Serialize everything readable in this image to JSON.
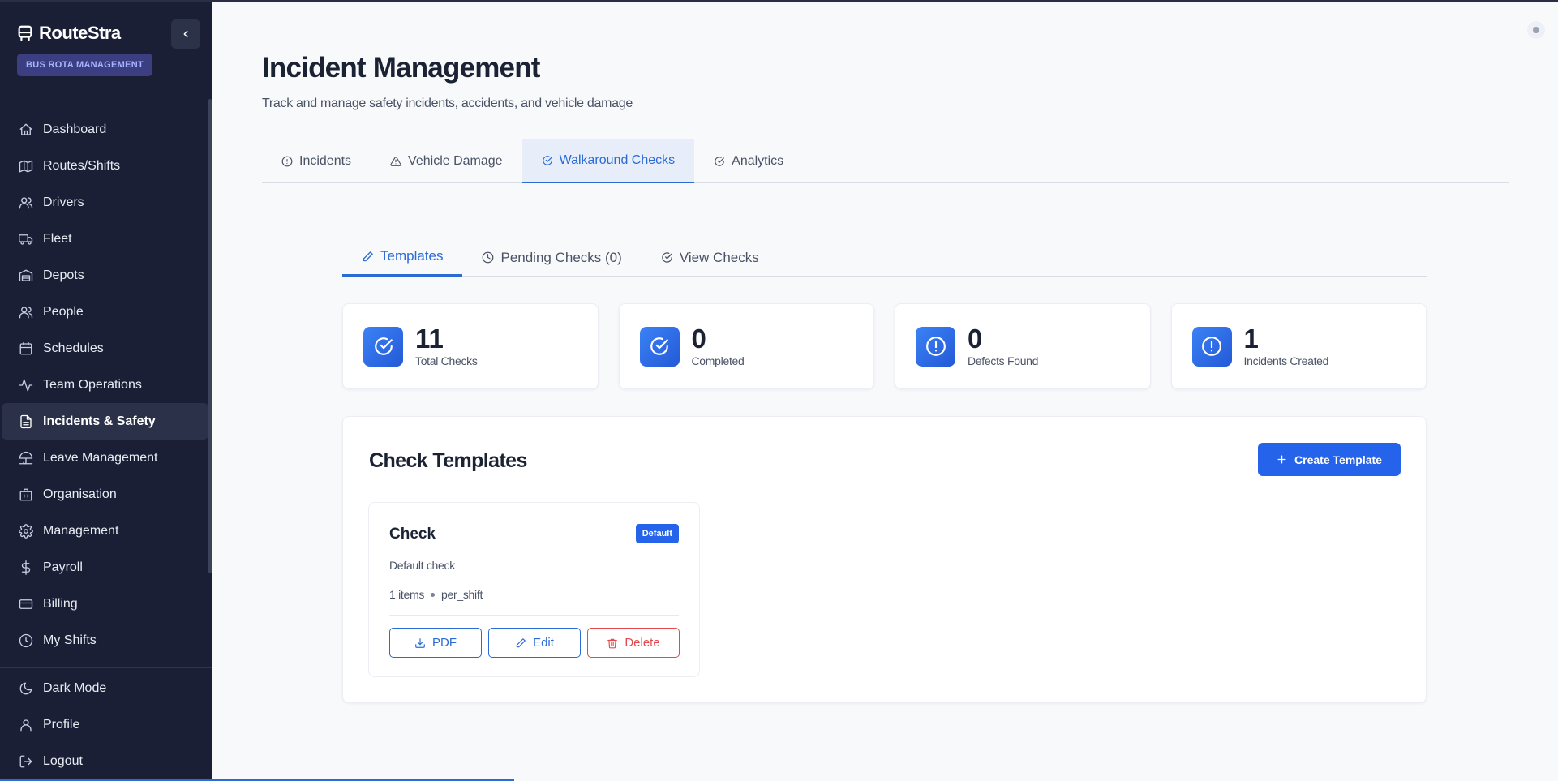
{
  "app": {
    "brand_name": "RouteStra",
    "brand_badge": "BUS ROTA MANAGEMENT"
  },
  "sidebar": {
    "items": [
      {
        "label": "Dashboard",
        "icon": "home-icon"
      },
      {
        "label": "Routes/Shifts",
        "icon": "map-icon"
      },
      {
        "label": "Drivers",
        "icon": "users-icon"
      },
      {
        "label": "Fleet",
        "icon": "truck-icon"
      },
      {
        "label": "Depots",
        "icon": "warehouse-icon"
      },
      {
        "label": "People",
        "icon": "users-icon"
      },
      {
        "label": "Schedules",
        "icon": "calendar-icon"
      },
      {
        "label": "Team Operations",
        "icon": "activity-icon"
      },
      {
        "label": "Incidents & Safety",
        "icon": "file-icon",
        "active": true
      },
      {
        "label": "Leave Management",
        "icon": "umbrella-icon"
      },
      {
        "label": "Organisation",
        "icon": "building-icon"
      },
      {
        "label": "Management",
        "icon": "gear-icon"
      },
      {
        "label": "Payroll",
        "icon": "dollar-icon"
      },
      {
        "label": "Billing",
        "icon": "credit-card-icon"
      },
      {
        "label": "My Shifts",
        "icon": "clock-icon"
      }
    ],
    "bottom_items": [
      {
        "label": "Dark Mode",
        "icon": "moon-icon"
      },
      {
        "label": "Profile",
        "icon": "user-icon"
      },
      {
        "label": "Logout",
        "icon": "logout-icon"
      }
    ]
  },
  "header": {
    "title": "Incident Management",
    "subtitle": "Track and manage safety incidents, accidents, and vehicle damage"
  },
  "top_tabs": [
    {
      "label": "Incidents",
      "icon": "alert-circle-icon"
    },
    {
      "label": "Vehicle Damage",
      "icon": "alert-triangle-icon"
    },
    {
      "label": "Walkaround Checks",
      "icon": "check-circle-icon",
      "active": true
    },
    {
      "label": "Analytics",
      "icon": "check-circle-icon"
    }
  ],
  "sub_tabs": [
    {
      "label": "Templates",
      "icon": "pencil-icon",
      "active": true
    },
    {
      "label": "Pending Checks (0)",
      "icon": "clock-icon"
    },
    {
      "label": "View Checks",
      "icon": "check-circle-icon"
    }
  ],
  "stats": [
    {
      "value": "11",
      "label": "Total Checks",
      "icon": "check-circle-icon"
    },
    {
      "value": "0",
      "label": "Completed",
      "icon": "check-circle-icon"
    },
    {
      "value": "0",
      "label": "Defects Found",
      "icon": "alert-circle-icon"
    },
    {
      "value": "1",
      "label": "Incidents Created",
      "icon": "alert-circle-icon"
    }
  ],
  "templates_panel": {
    "title": "Check Templates",
    "create_label": "Create Template"
  },
  "template_card": {
    "name": "Check",
    "badge": "Default",
    "description": "Default check",
    "items_count": "1 items",
    "frequency": "per_shift",
    "pdf_label": "PDF",
    "edit_label": "Edit",
    "delete_label": "Delete"
  },
  "colors": {
    "accent": "#2563eb",
    "sidebar_bg": "#1a1f36",
    "danger": "#e5484d"
  },
  "page_load_progress": 0.33
}
